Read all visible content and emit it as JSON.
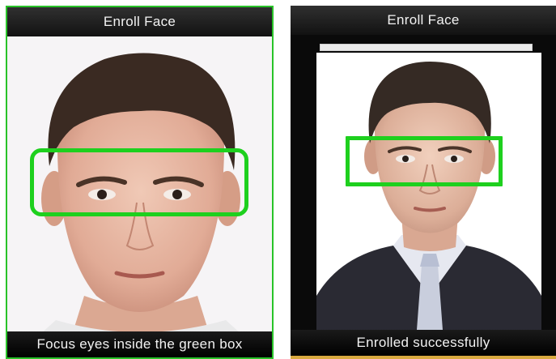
{
  "left_screen": {
    "title": "Enroll Face",
    "status": "Focus eyes inside the green box"
  },
  "right_screen": {
    "title": "Enroll Face",
    "status": "Enrolled successfully"
  },
  "colors": {
    "guide_box": "#1ed01e",
    "screen_border": "#29c329",
    "bar": "#121212",
    "text": "#f2f2f2"
  }
}
